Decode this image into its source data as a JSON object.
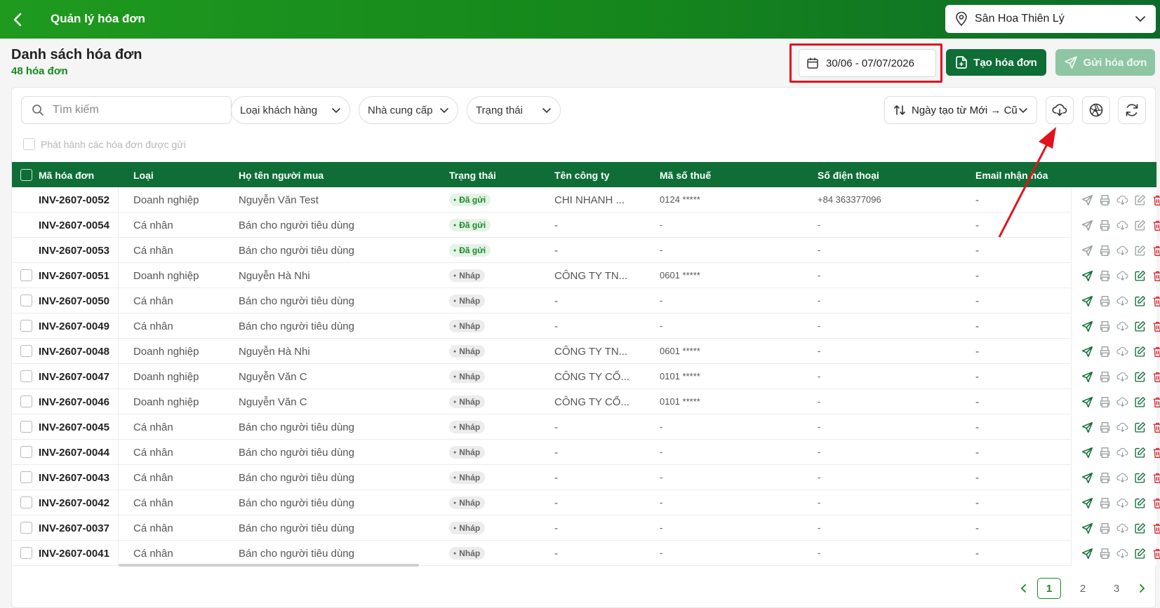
{
  "header": {
    "title": "Quản lý hóa đơn",
    "store": "Sân Hoa Thiên Lý"
  },
  "page": {
    "title": "Danh sách hóa đơn",
    "count": "48 hóa đơn",
    "date_range": "30/06 - 07/07/2026",
    "create_label": "Tạo hóa đơn",
    "send_label": "Gửi hóa đơn"
  },
  "filters": {
    "search_placeholder": "Tìm kiếm",
    "customer_type": "Loại khách hàng",
    "supplier": "Nhà cung cấp",
    "status": "Trạng thái",
    "sort": "Ngày tạo từ Mới → Cũ",
    "publish_label": "Phát hành các hóa đơn được gửi"
  },
  "table": {
    "columns": [
      "Mã hóa đơn",
      "Loại",
      "Họ tên người mua",
      "Trạng thái",
      "Tên công ty",
      "Mã số thuế",
      "Số điện thoại",
      "Email nhận hóa"
    ],
    "rows": [
      {
        "code": "INV-2607-0052",
        "type": "Doanh nghiệp",
        "buyer": "Nguyễn Văn Test",
        "status": "Đã gửi",
        "company": "CHI NHANH ...",
        "tax": "0124 *****",
        "phone": "+84 363377096",
        "email": "-"
      },
      {
        "code": "INV-2607-0054",
        "type": "Cá nhân",
        "buyer": "Bán cho người tiêu dùng",
        "status": "Đã gửi",
        "company": "-",
        "tax": "-",
        "phone": "-",
        "email": "-"
      },
      {
        "code": "INV-2607-0053",
        "type": "Cá nhân",
        "buyer": "Bán cho người tiêu dùng",
        "status": "Đã gửi",
        "company": "-",
        "tax": "-",
        "phone": "-",
        "email": "-"
      },
      {
        "code": "INV-2607-0051",
        "type": "Doanh nghiệp",
        "buyer": "Nguyễn Hà Nhi",
        "status": "Nháp",
        "company": "CÔNG TY TN...",
        "tax": "0601 *****",
        "phone": "-",
        "email": "-"
      },
      {
        "code": "INV-2607-0050",
        "type": "Cá nhân",
        "buyer": "Bán cho người tiêu dùng",
        "status": "Nháp",
        "company": "-",
        "tax": "-",
        "phone": "-",
        "email": "-"
      },
      {
        "code": "INV-2607-0049",
        "type": "Cá nhân",
        "buyer": "Bán cho người tiêu dùng",
        "status": "Nháp",
        "company": "-",
        "tax": "-",
        "phone": "-",
        "email": "-"
      },
      {
        "code": "INV-2607-0048",
        "type": "Doanh nghiệp",
        "buyer": "Nguyễn Hà Nhi",
        "status": "Nháp",
        "company": "CÔNG TY TN...",
        "tax": "0601 *****",
        "phone": "-",
        "email": "-"
      },
      {
        "code": "INV-2607-0047",
        "type": "Doanh nghiệp",
        "buyer": "Nguyễn Văn C",
        "status": "Nháp",
        "company": "CÔNG TY CỔ...",
        "tax": "0101 *****",
        "phone": "-",
        "email": "-"
      },
      {
        "code": "INV-2607-0046",
        "type": "Doanh nghiệp",
        "buyer": "Nguyễn Văn C",
        "status": "Nháp",
        "company": "CÔNG TY CỔ...",
        "tax": "0101 *****",
        "phone": "-",
        "email": "-"
      },
      {
        "code": "INV-2607-0045",
        "type": "Cá nhân",
        "buyer": "Bán cho người tiêu dùng",
        "status": "Nháp",
        "company": "-",
        "tax": "-",
        "phone": "-",
        "email": "-"
      },
      {
        "code": "INV-2607-0044",
        "type": "Cá nhân",
        "buyer": "Bán cho người tiêu dùng",
        "status": "Nháp",
        "company": "-",
        "tax": "-",
        "phone": "-",
        "email": "-"
      },
      {
        "code": "INV-2607-0043",
        "type": "Cá nhân",
        "buyer": "Bán cho người tiêu dùng",
        "status": "Nháp",
        "company": "-",
        "tax": "-",
        "phone": "-",
        "email": "-"
      },
      {
        "code": "INV-2607-0042",
        "type": "Cá nhân",
        "buyer": "Bán cho người tiêu dùng",
        "status": "Nháp",
        "company": "-",
        "tax": "-",
        "phone": "-",
        "email": "-"
      },
      {
        "code": "INV-2607-0037",
        "type": "Cá nhân",
        "buyer": "Bán cho người tiêu dùng",
        "status": "Nháp",
        "company": "-",
        "tax": "-",
        "phone": "-",
        "email": "-"
      },
      {
        "code": "INV-2607-0041",
        "type": "Cá nhân",
        "buyer": "Bán cho người tiêu dùng",
        "status": "Nháp",
        "company": "-",
        "tax": "-",
        "phone": "-",
        "email": "-"
      }
    ]
  },
  "pagination": {
    "pages": [
      "1",
      "2",
      "3"
    ],
    "current": "1"
  },
  "colors": {
    "primary": "#0e6e36",
    "accent": "#17881e",
    "danger": "#d9262c",
    "annotation": "#e1121e"
  },
  "icons": {
    "row_actions": [
      "send-icon",
      "print-icon",
      "cloud-download-icon",
      "edit-icon",
      "delete-icon"
    ],
    "toolbar": [
      "cloud-download-icon",
      "aperture-icon",
      "refresh-icon"
    ]
  }
}
